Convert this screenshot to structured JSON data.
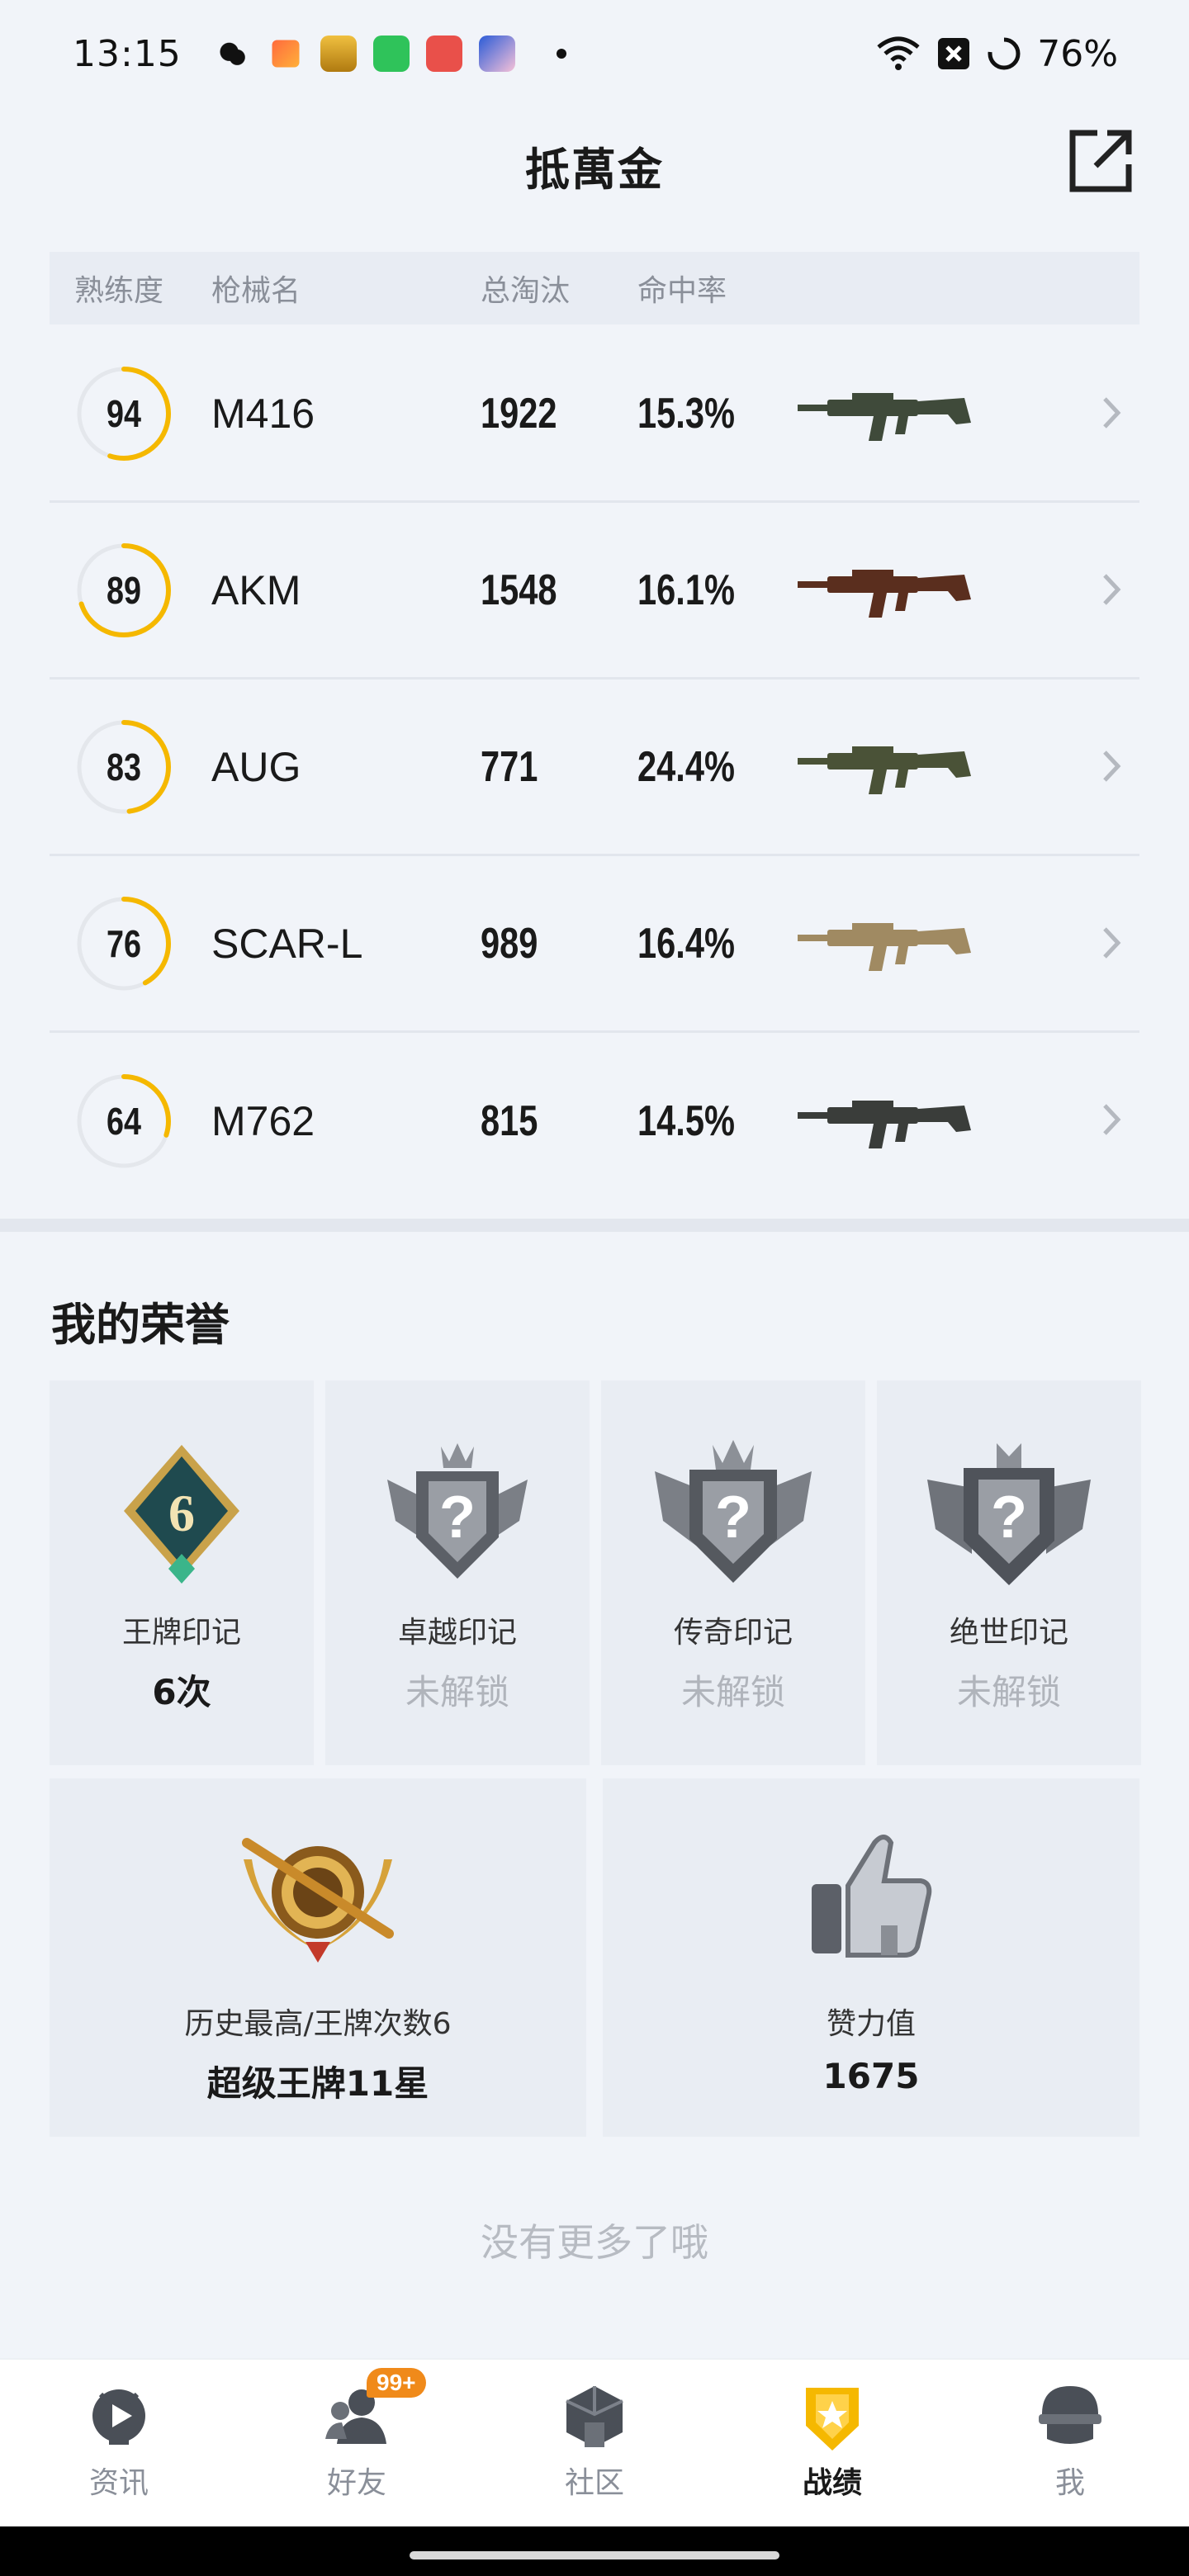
{
  "status_bar": {
    "time": "13:15",
    "battery": "76%"
  },
  "header": {
    "title": "抵萬金"
  },
  "table": {
    "headers": {
      "mastery": "熟练度",
      "name": "枪械名",
      "kills": "总淘汰",
      "accuracy": "命中率"
    },
    "rows": [
      {
        "mastery": "94",
        "name": "M416",
        "kills": "1922",
        "accuracy": "15.3%",
        "level": 0.55,
        "gun_color": "#3f4a3a"
      },
      {
        "mastery": "89",
        "name": "AKM",
        "kills": "1548",
        "accuracy": "16.1%",
        "level": 0.7,
        "gun_color": "#5a2e1e"
      },
      {
        "mastery": "83",
        "name": "AUG",
        "kills": "771",
        "accuracy": "24.4%",
        "level": 0.48,
        "gun_color": "#4a5237"
      },
      {
        "mastery": "76",
        "name": "SCAR-L",
        "kills": "989",
        "accuracy": "16.4%",
        "level": 0.42,
        "gun_color": "#a08a62"
      },
      {
        "mastery": "64",
        "name": "M762",
        "kills": "815",
        "accuracy": "14.5%",
        "level": 0.3,
        "gun_color": "#3a3d3a"
      }
    ]
  },
  "honors": {
    "title": "我的荣誉",
    "badges": [
      {
        "label": "王牌印记",
        "value": "6次",
        "icon": "ace-mark-icon",
        "badge_text": "6",
        "locked": false
      },
      {
        "label": "卓越印记",
        "value": "未解锁",
        "icon": "excellence-mark-icon",
        "badge_text": "?",
        "locked": true
      },
      {
        "label": "传奇印记",
        "value": "未解锁",
        "icon": "legend-mark-icon",
        "badge_text": "?",
        "locked": true
      },
      {
        "label": "绝世印记",
        "value": "未解锁",
        "icon": "peerless-mark-icon",
        "badge_text": "?",
        "locked": true
      }
    ],
    "highest": {
      "label": "历史最高/王牌次数6",
      "value": "超级王牌11星"
    },
    "likes": {
      "label": "赞力值",
      "value": "1675"
    }
  },
  "footer_note": "没有更多了哦",
  "nav": {
    "items": [
      {
        "label": "资讯",
        "icon": "news-icon"
      },
      {
        "label": "好友",
        "icon": "friends-icon",
        "badge": "99+"
      },
      {
        "label": "社区",
        "icon": "community-icon"
      },
      {
        "label": "战绩",
        "icon": "record-icon",
        "active": true
      },
      {
        "label": "我",
        "icon": "profile-icon"
      }
    ]
  },
  "colors": {
    "accent": "#f5b800",
    "ring_track": "#e4e7ec",
    "badge_orange": "#f08a1a"
  }
}
